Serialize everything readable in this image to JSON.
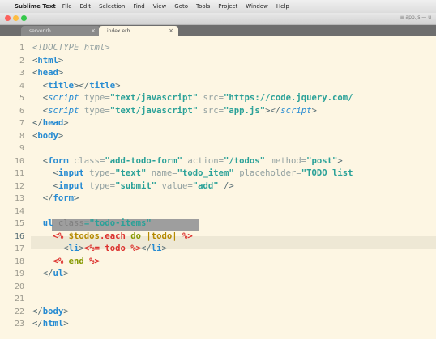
{
  "menubar": {
    "app": "Sublime Text",
    "items": [
      "File",
      "Edit",
      "Selection",
      "Find",
      "View",
      "Goto",
      "Tools",
      "Project",
      "Window",
      "Help"
    ]
  },
  "titlebar": {
    "info": "≡ app.js — u"
  },
  "tabs": [
    {
      "label": "server.rb",
      "close": "×"
    },
    {
      "label": "index.erb",
      "close": "×"
    }
  ],
  "editor": {
    "line_numbers": [
      "1",
      "2",
      "3",
      "4",
      "5",
      "6",
      "7",
      "8",
      "9",
      "10",
      "11",
      "12",
      "13",
      "14",
      "15",
      "16",
      "17",
      "18",
      "19",
      "20",
      "21",
      "22",
      "23"
    ],
    "current_line": "16",
    "code": {
      "l1": "<!DOCTYPE html>",
      "l2_open": "<",
      "l2_tag": "html",
      "l2_close": ">",
      "l3_open": "<",
      "l3_tag": "head",
      "l3_close": ">",
      "l4_indent": "  ",
      "l4_open": "<",
      "l4_tag": "title",
      "l4_mid": "></",
      "l4_tag2": "title",
      "l4_close": ">",
      "l5_indent": "  ",
      "l5_open": "<",
      "l5_tag": "script",
      "l5_attr1": " type=",
      "l5_val1": "\"text/javascript\"",
      "l5_attr2": " src=",
      "l5_val2": "\"https://code.jquery.com/",
      "l6_indent": "  ",
      "l6_open": "<",
      "l6_tag": "script",
      "l6_attr1": " type=",
      "l6_val1": "\"text/javascript\"",
      "l6_attr2": " src=",
      "l6_val2": "\"app.js\"",
      "l6_mid": "></",
      "l6_tag2": "script",
      "l6_close": ">",
      "l7_open": "</",
      "l7_tag": "head",
      "l7_close": ">",
      "l8_open": "<",
      "l8_tag": "body",
      "l8_close": ">",
      "l10_indent": "  ",
      "l10_open": "<",
      "l10_tag": "form",
      "l10_attr1": " class=",
      "l10_val1": "\"add-todo-form\"",
      "l10_attr2": " action=",
      "l10_val2": "\"/todos\"",
      "l10_attr3": " method=",
      "l10_val3": "\"post\"",
      "l10_close": ">",
      "l11_indent": "    ",
      "l11_open": "<",
      "l11_tag": "input",
      "l11_attr1": " type=",
      "l11_val1": "\"text\"",
      "l11_attr2": " name=",
      "l11_val2": "\"todo_item\"",
      "l11_attr3": " placeholder=",
      "l11_val3": "\"TODO list",
      "l12_indent": "    ",
      "l12_open": "<",
      "l12_tag": "input",
      "l12_attr1": " type=",
      "l12_val1": "\"submit\"",
      "l12_attr2": " value=",
      "l12_val2": "\"add\"",
      "l12_close": " />",
      "l13_indent": "  ",
      "l13_open": "</",
      "l13_tag": "form",
      "l13_close": ">",
      "l15_indent": "  ",
      "l15_tag": "ul",
      "l15_attr": " class",
      "l15_val": "=\"todo-items\"",
      "l16_indent": "    ",
      "l16_erb_open": "<%",
      "l16_var": " $todos",
      "l16_meth": ".each",
      "l16_kw": " do",
      "l16_block": " |todo|",
      "l16_erb_close": " %>",
      "l17_indent": "      ",
      "l17_open": "<",
      "l17_tag": "li",
      "l17_close": ">",
      "l17_erb_open": "<%=",
      "l17_expr": " todo",
      "l17_erb_close": " %>",
      "l17_end_open": "</",
      "l17_tag2": "li",
      "l17_end_close": ">",
      "l18_indent": "    ",
      "l18_erb_open": "<%",
      "l18_kw": " end",
      "l18_erb_close": " %>",
      "l19_indent": "  ",
      "l19_open": "</",
      "l19_tag": "ul",
      "l19_close": ">",
      "l22_open": "</",
      "l22_tag": "body",
      "l22_close": ">",
      "l23_open": "</",
      "l23_tag": "html",
      "l23_close": ">"
    }
  },
  "colors": {
    "background": "#fdf6e3",
    "tag": "#268bd2",
    "string": "#2aa198",
    "erb_delimiter": "#dc322f",
    "keyword": "#859900",
    "selection": "#9e9e9e"
  }
}
